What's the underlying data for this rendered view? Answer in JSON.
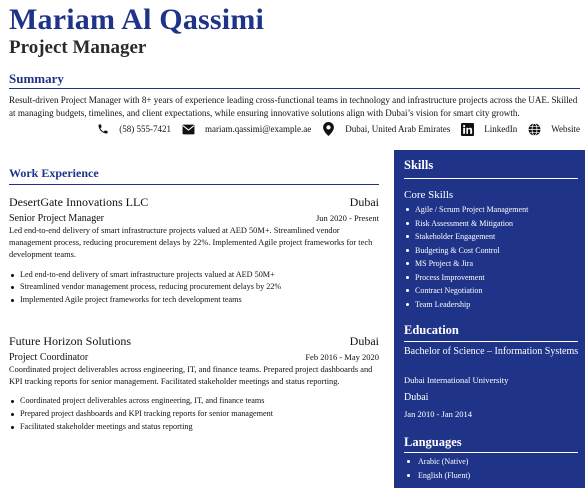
{
  "header": {
    "name": "Mariam Al Qassimi",
    "role": "Project Manager"
  },
  "summary": {
    "heading": "Summary",
    "text": "Result-driven Project Manager with 8+ years of experience leading cross-functional teams in technology and infrastructure projects across the UAE. Skilled at managing budgets, timelines, and client expectations, while ensuring innovative solutions align with Dubai’s vision for smart city growth."
  },
  "contact": {
    "phone": "(58) 555-7421",
    "email": "mariam.qassimi@example.ae",
    "location": "Dubai, United Arab Emirates",
    "linkedin": "LinkedIn",
    "website": "Website",
    "icons": [
      "phone-icon",
      "email-icon",
      "location-pin-icon",
      "linkedin-icon",
      "globe-icon"
    ]
  },
  "experience": {
    "heading": "Work Experience",
    "jobs": [
      {
        "company": "DesertGate Innovations LLC",
        "location": "Dubai",
        "title": "Senior Project Manager",
        "dates": "Jun 2020 - Present",
        "description": "Led end-to-end delivery of smart infrastructure projects valued at AED 50M+. Streamlined vendor management process, reducing procurement delays by 22%. Implemented Agile project frameworks for tech development teams.",
        "bullets": [
          "Led end-to-end delivery of smart infrastructure projects valued at AED 50M+",
          "Streamlined vendor management process, reducing procurement delays by 22%",
          "Implemented Agile project frameworks for tech development teams"
        ]
      },
      {
        "company": "Future Horizon Solutions",
        "location": "Dubai",
        "title": "Project Coordinator",
        "dates": "Feb 2016 - May 2020",
        "description": "Coordinated project deliverables across engineering, IT, and finance teams. Prepared project dashboards and KPI tracking reports for senior management. Facilitated stakeholder meetings and status reporting.",
        "bullets": [
          "Coordinated project deliverables across engineering, IT, and finance teams",
          "Prepared project dashboards and KPI tracking reports for senior management",
          "Facilitated stakeholder meetings and status reporting"
        ]
      }
    ]
  },
  "sidebar": {
    "skills_heading": "Skills",
    "core_heading": "Core Skills",
    "skills": [
      "Agile / Scrum Project Management",
      "Risk Assessment & Mitigation",
      "Stakeholder Engagement",
      "Budgeting & Cost Control",
      "MS Project & Jira",
      "Process Improvement",
      "Contract Negotiation",
      "Team Leadership"
    ],
    "education_heading": "Education",
    "education": {
      "degree": "Bachelor of Science – Information Systems",
      "school": "Dubai International University",
      "city": "Dubai",
      "dates": "Jan 2010 - Jan 2014"
    },
    "languages_heading": "Languages",
    "languages": [
      "Arabic (Native)",
      "English (Fluent)"
    ]
  },
  "colors": {
    "accent": "#1f3488",
    "sidebar_bg": "#1f3488",
    "text": "#111111"
  }
}
